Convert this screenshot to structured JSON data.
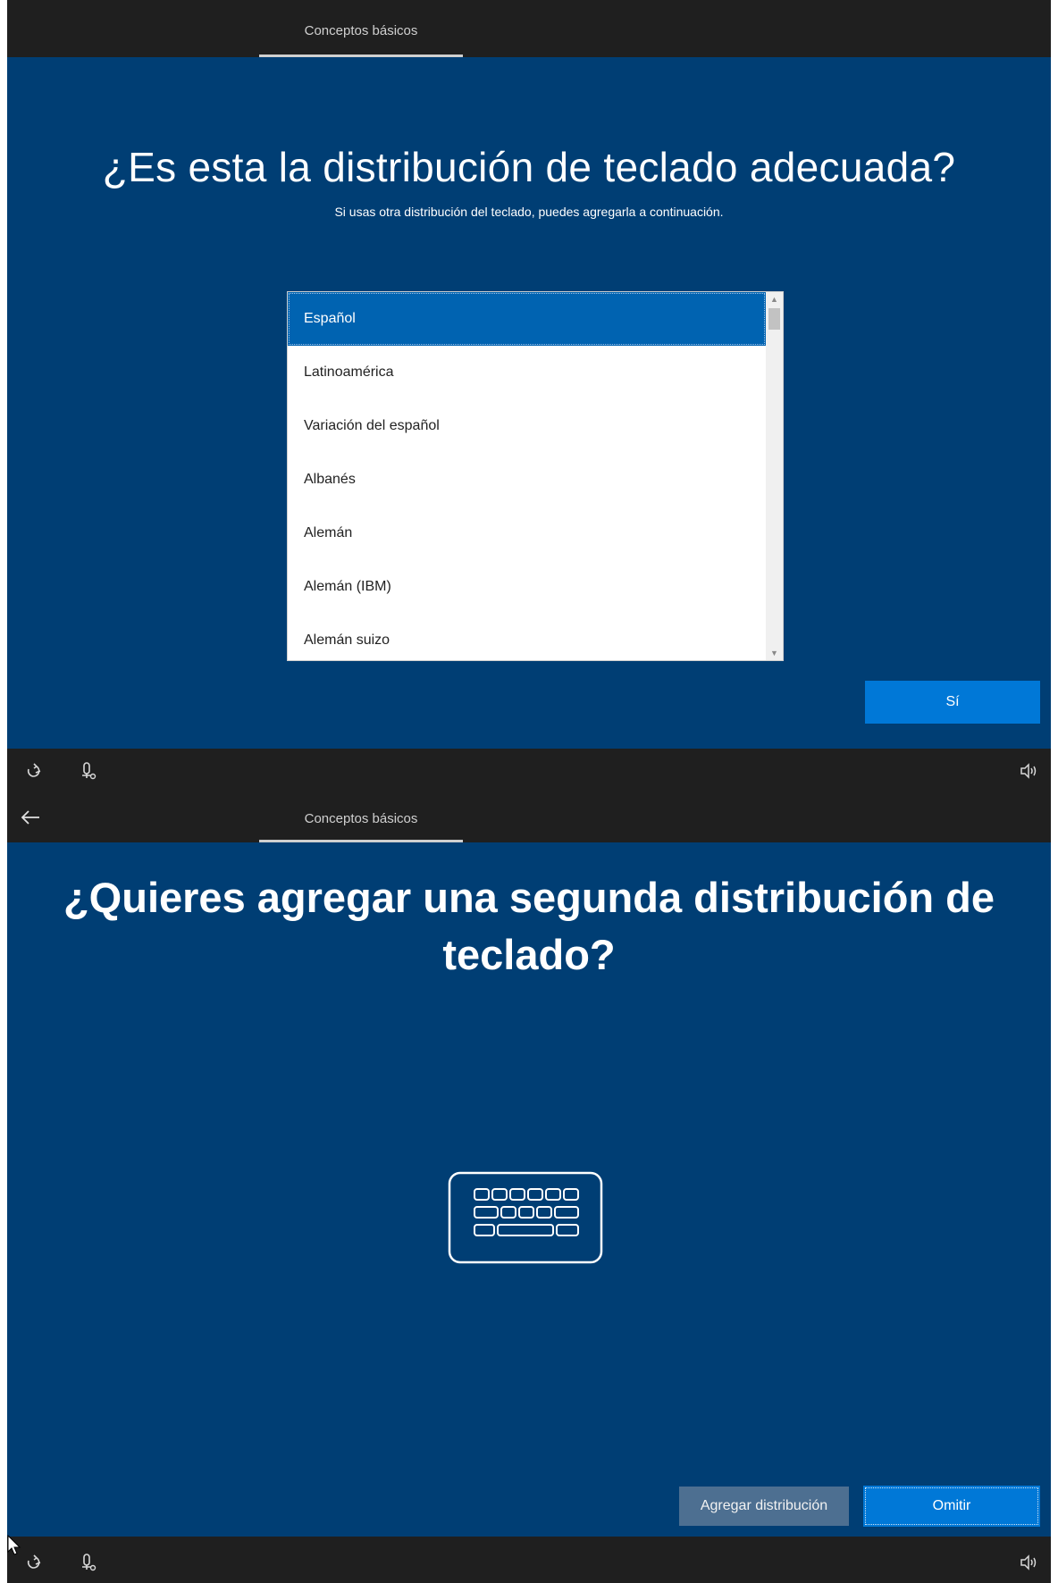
{
  "screen1": {
    "tab_label": "Conceptos básicos",
    "title": "¿Es esta la distribución de teclado adecuada?",
    "subtitle": "Si usas otra distribución del teclado, puedes agregarla a continuación.",
    "layouts": [
      {
        "label": "Español",
        "selected": true
      },
      {
        "label": "Latinoamérica",
        "selected": false
      },
      {
        "label": "Variación del español",
        "selected": false
      },
      {
        "label": "Albanés",
        "selected": false
      },
      {
        "label": "Alemán",
        "selected": false
      },
      {
        "label": "Alemán (IBM)",
        "selected": false
      },
      {
        "label": "Alemán suizo",
        "selected": false
      }
    ],
    "confirm_button": "Sí"
  },
  "screen2": {
    "tab_label": "Conceptos básicos",
    "title": "¿Quieres agregar una segunda distribución de teclado?",
    "add_button": "Agregar distribución",
    "skip_button": "Omitir"
  },
  "icons": {
    "ease_of_access": "ease-of-access-icon",
    "microphone": "microphone-icon",
    "volume": "volume-icon",
    "back": "back-arrow-icon",
    "keyboard": "keyboard-icon"
  },
  "colors": {
    "panel_bg": "#003e74",
    "bar_bg": "#1f1f1f",
    "accent": "#0078d7",
    "selected_item": "#0063b1",
    "secondary_button": "#4d6f91"
  }
}
